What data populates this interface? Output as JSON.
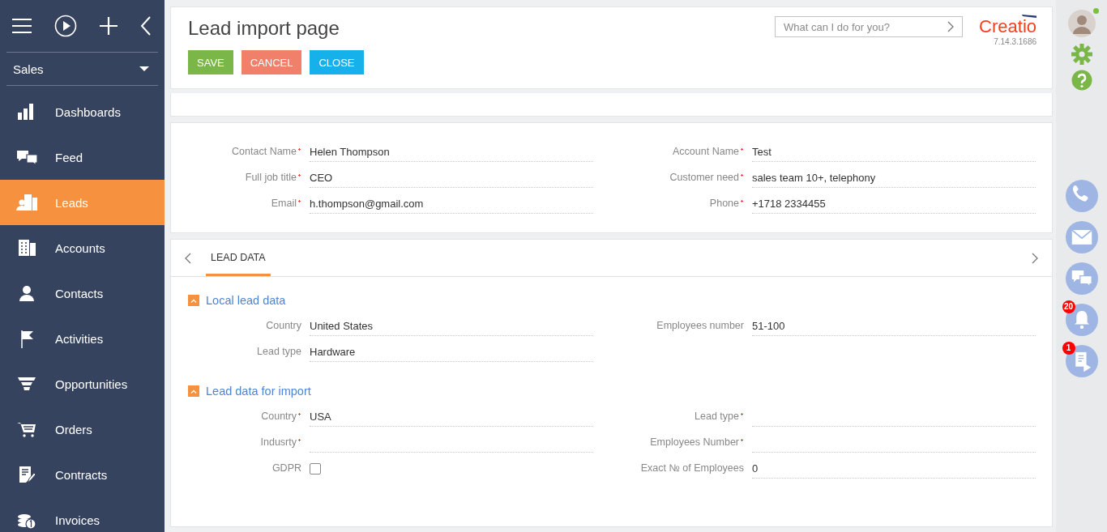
{
  "sidebar": {
    "workplace": "Sales",
    "items": [
      {
        "label": "Dashboards",
        "selected": false
      },
      {
        "label": "Feed",
        "selected": false
      },
      {
        "label": "Leads",
        "selected": true
      },
      {
        "label": "Accounts",
        "selected": false
      },
      {
        "label": "Contacts",
        "selected": false
      },
      {
        "label": "Activities",
        "selected": false
      },
      {
        "label": "Opportunities",
        "selected": false
      },
      {
        "label": "Orders",
        "selected": false
      },
      {
        "label": "Contracts",
        "selected": false
      },
      {
        "label": "Invoices",
        "selected": false
      }
    ]
  },
  "header": {
    "title": "Lead import page",
    "buttons": [
      {
        "label": "SAVE",
        "kind": "save"
      },
      {
        "label": "CANCEL",
        "kind": "cancel"
      },
      {
        "label": "CLOSE",
        "kind": "close"
      }
    ],
    "search": {
      "placeholder": "What can I do for you?"
    },
    "logo": "Creatio",
    "version": "7.14.3.1686"
  },
  "main_fields": {
    "left": [
      {
        "label": "Contact Name",
        "required": true,
        "value": "Helen Thompson"
      },
      {
        "label": "Full job title",
        "required": true,
        "value": "CEO"
      },
      {
        "label": "Email",
        "required": true,
        "value": "h.thompson@gmail.com"
      }
    ],
    "right": [
      {
        "label": "Account Name",
        "required": true,
        "value": "Test"
      },
      {
        "label": "Customer need",
        "required": true,
        "value": "sales team 10+, telephony"
      },
      {
        "label": "Phone",
        "required": true,
        "value": "+1718 2334455"
      }
    ]
  },
  "tabs": [
    {
      "label": "LEAD DATA",
      "selected": true
    }
  ],
  "sections": [
    {
      "title": "Local lead data",
      "expanded": true,
      "left": [
        {
          "label": "Country",
          "required": false,
          "value": "United States"
        },
        {
          "label": "Lead type",
          "required": false,
          "value": "Hardware"
        }
      ],
      "right": [
        {
          "label": "Employees number",
          "required": false,
          "value": "51-100"
        }
      ]
    },
    {
      "title": "Lead data for import",
      "expanded": true,
      "left": [
        {
          "kind": "text",
          "label": "Country",
          "required": true,
          "value": "USA"
        },
        {
          "kind": "text",
          "label": "Indusrty",
          "required": true
        },
        {
          "kind": "checkbox",
          "label": "GDPR",
          "required": false,
          "checked": false
        }
      ],
      "right": [
        {
          "label": "Lead type",
          "required": true
        },
        {
          "label": "Employees Number",
          "required": true
        },
        {
          "label": "Exact № of Employees",
          "required": false,
          "value": "0"
        }
      ]
    }
  ],
  "right_bar": {
    "online": true,
    "notifications": {
      "badge": "20"
    },
    "processes": {
      "badge": "1"
    }
  }
}
